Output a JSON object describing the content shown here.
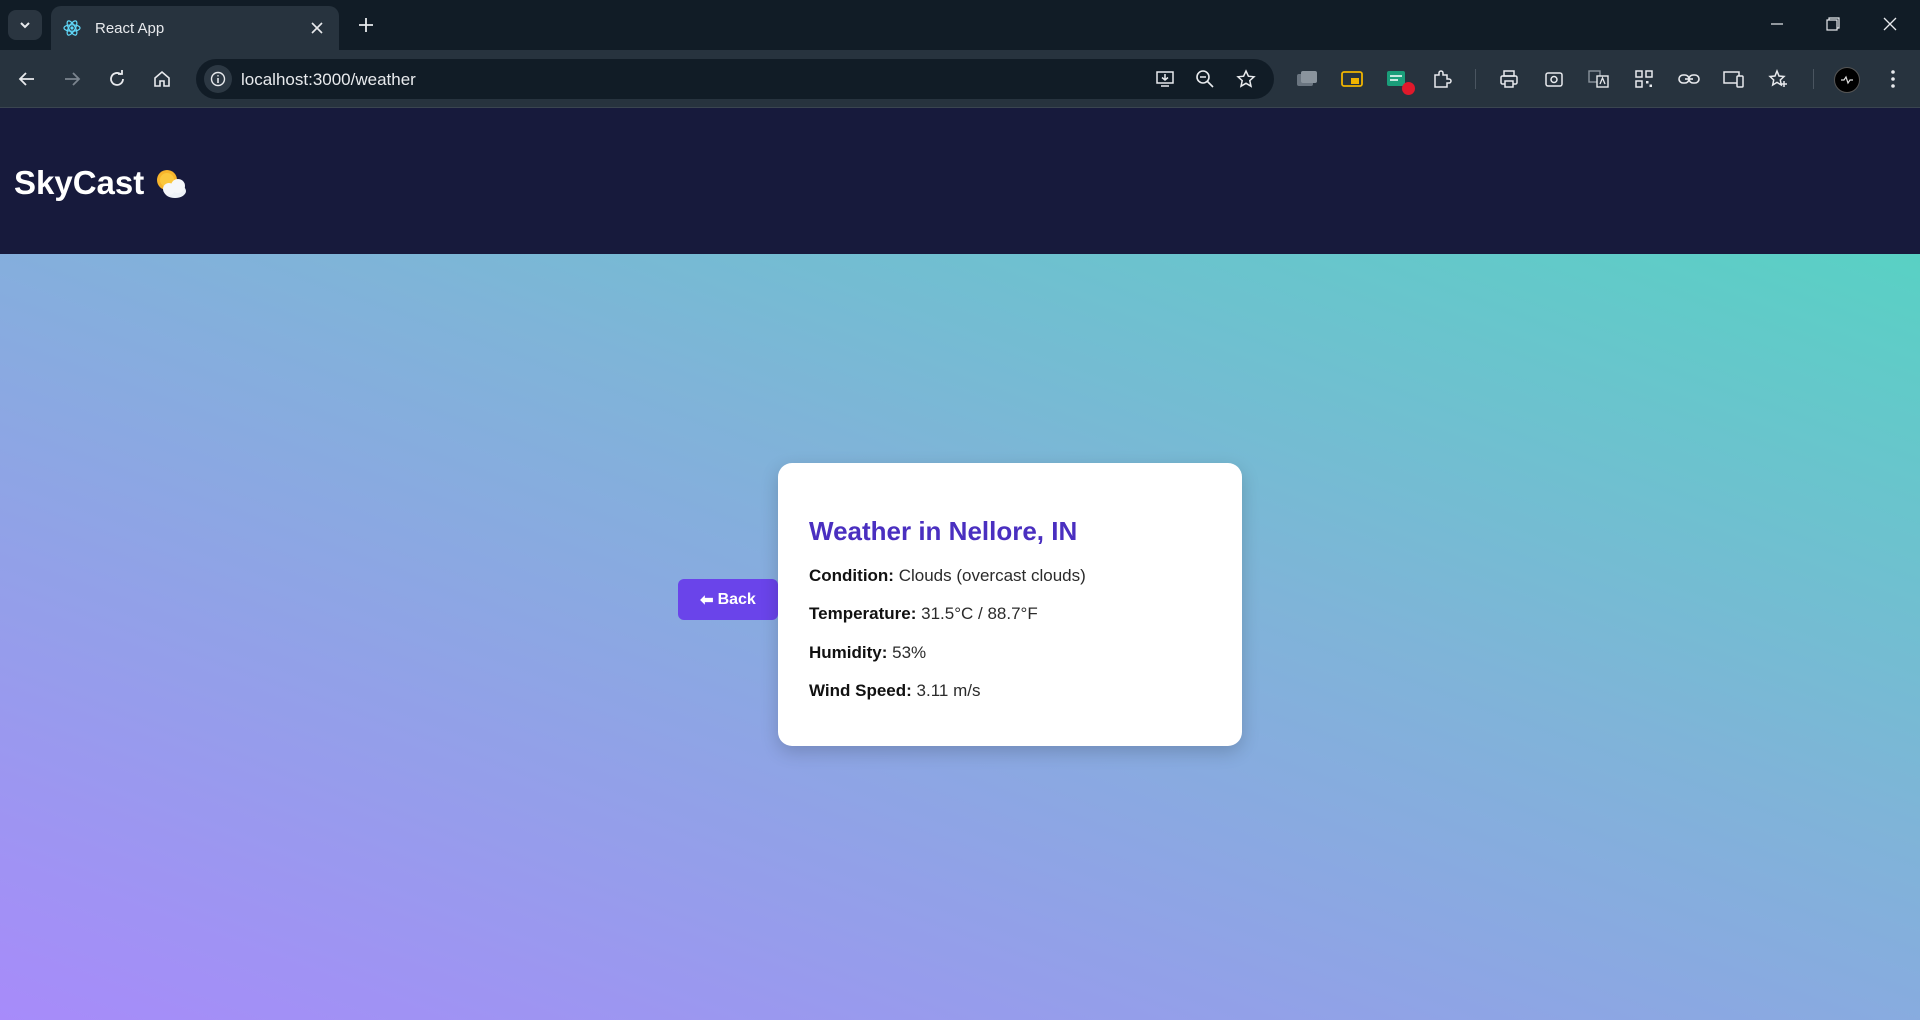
{
  "browser": {
    "tab_title": "React App",
    "url": "localhost:3000/weather"
  },
  "app": {
    "brand": "SkyCast",
    "brand_emoji": "sun-behind-cloud-emoji"
  },
  "back_button": {
    "arrow": "⬅",
    "label": "Back"
  },
  "weather_card": {
    "title": "Weather in Nellore, IN",
    "rows": [
      {
        "label": "Condition:",
        "value": "Clouds (overcast clouds)"
      },
      {
        "label": "Temperature:",
        "value": "31.5°C / 88.7°F"
      },
      {
        "label": "Humidity:",
        "value": "53%"
      },
      {
        "label": "Wind Speed:",
        "value": "3.11 m/s"
      }
    ]
  },
  "colors": {
    "header_bg": "#171a3c",
    "accent": "#6a44ea",
    "title_color": "#4a2fc0",
    "gradient_start": "#a78bfa",
    "gradient_end": "#4fd8bf"
  }
}
